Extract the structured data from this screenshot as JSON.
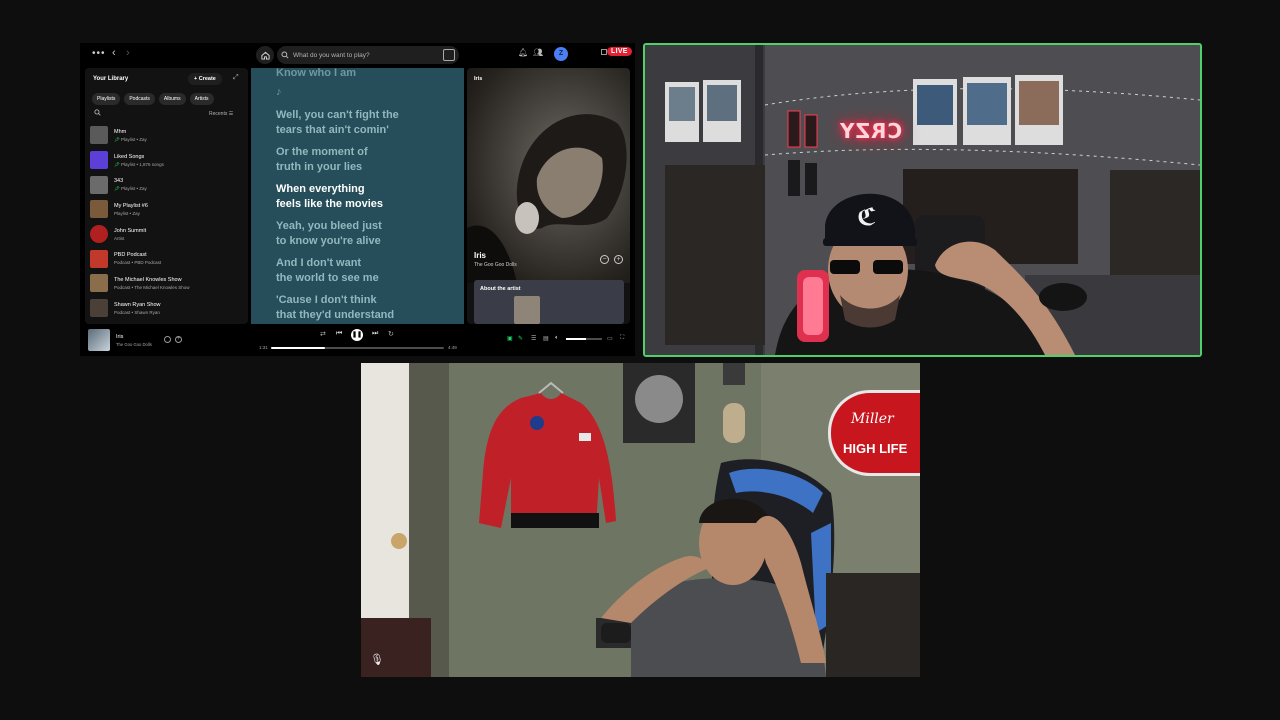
{
  "spotify": {
    "search_placeholder": "What do you want to play?",
    "avatar_initial": "Z",
    "live_badge": "LIVE",
    "library": {
      "title": "Your Library",
      "create_label": "Create",
      "chips": [
        "Playlists",
        "Podcasts",
        "Albums",
        "Artists"
      ],
      "recents_label": "Recents",
      "items": [
        {
          "name": "Mhm",
          "sub": "Playlist • Zay",
          "pinned": true,
          "thumb": "#5a5a5a"
        },
        {
          "name": "Liked Songs",
          "sub": "Playlist • 1,876 songs",
          "pinned": true,
          "thumb": "#5b3fd6"
        },
        {
          "name": "343",
          "sub": "Playlist • Zay",
          "pinned": true,
          "thumb": "#6b6b6b"
        },
        {
          "name": "My Playlist #6",
          "sub": "Playlist • Zay",
          "pinned": false,
          "thumb": "#7a5a3a"
        },
        {
          "name": "John Summit",
          "sub": "Artist",
          "pinned": false,
          "thumb": "#b02020",
          "round": true
        },
        {
          "name": "PBD Podcast",
          "sub": "Podcast • PBD Podcast",
          "pinned": false,
          "thumb": "#c0392b"
        },
        {
          "name": "The Michael Knowles Show",
          "sub": "Podcast • The Michael Knowles Show",
          "pinned": false,
          "thumb": "#8a6d4a"
        },
        {
          "name": "Shawn Ryan Show",
          "sub": "Podcast • Shawn Ryan",
          "pinned": false,
          "thumb": "#4a4038"
        }
      ]
    },
    "lyrics": [
      {
        "text": "Know who I am",
        "state": "past"
      },
      {
        "text": "♪",
        "state": "past"
      },
      {
        "text": "Well, you can't fight the",
        "state": "past"
      },
      {
        "text": "tears that ain't comin'",
        "state": "past"
      },
      {
        "text": "Or the moment of",
        "state": "past"
      },
      {
        "text": "truth in your lies",
        "state": "past"
      },
      {
        "text": "When everything",
        "state": "active"
      },
      {
        "text": "feels like the movies",
        "state": "active"
      },
      {
        "text": "Yeah, you bleed just",
        "state": "upcoming"
      },
      {
        "text": "to know you're alive",
        "state": "upcoming"
      },
      {
        "text": "And I don't want",
        "state": "upcoming"
      },
      {
        "text": "the world to see me",
        "state": "upcoming"
      },
      {
        "text": "'Cause I don't think",
        "state": "upcoming"
      },
      {
        "text": "that they'd understand",
        "state": "upcoming"
      }
    ],
    "now_playing": {
      "panel_label": "Iris",
      "title": "Iris",
      "artist": "The Goo Goo Dolls",
      "about_label": "About the artist"
    },
    "player": {
      "title": "Iris",
      "artist": "The Goo Goo Dolls",
      "elapsed": "1:31",
      "duration": "4:49",
      "progress": 0.315,
      "volume": 0.55
    }
  },
  "webcams": {
    "right_cam_neon_sign": "CRZY",
    "bottom_cam_sign_line1": "Miller",
    "bottom_cam_sign_line2": "HIGH LIFE",
    "accent_border_color": "#4ed06a"
  }
}
